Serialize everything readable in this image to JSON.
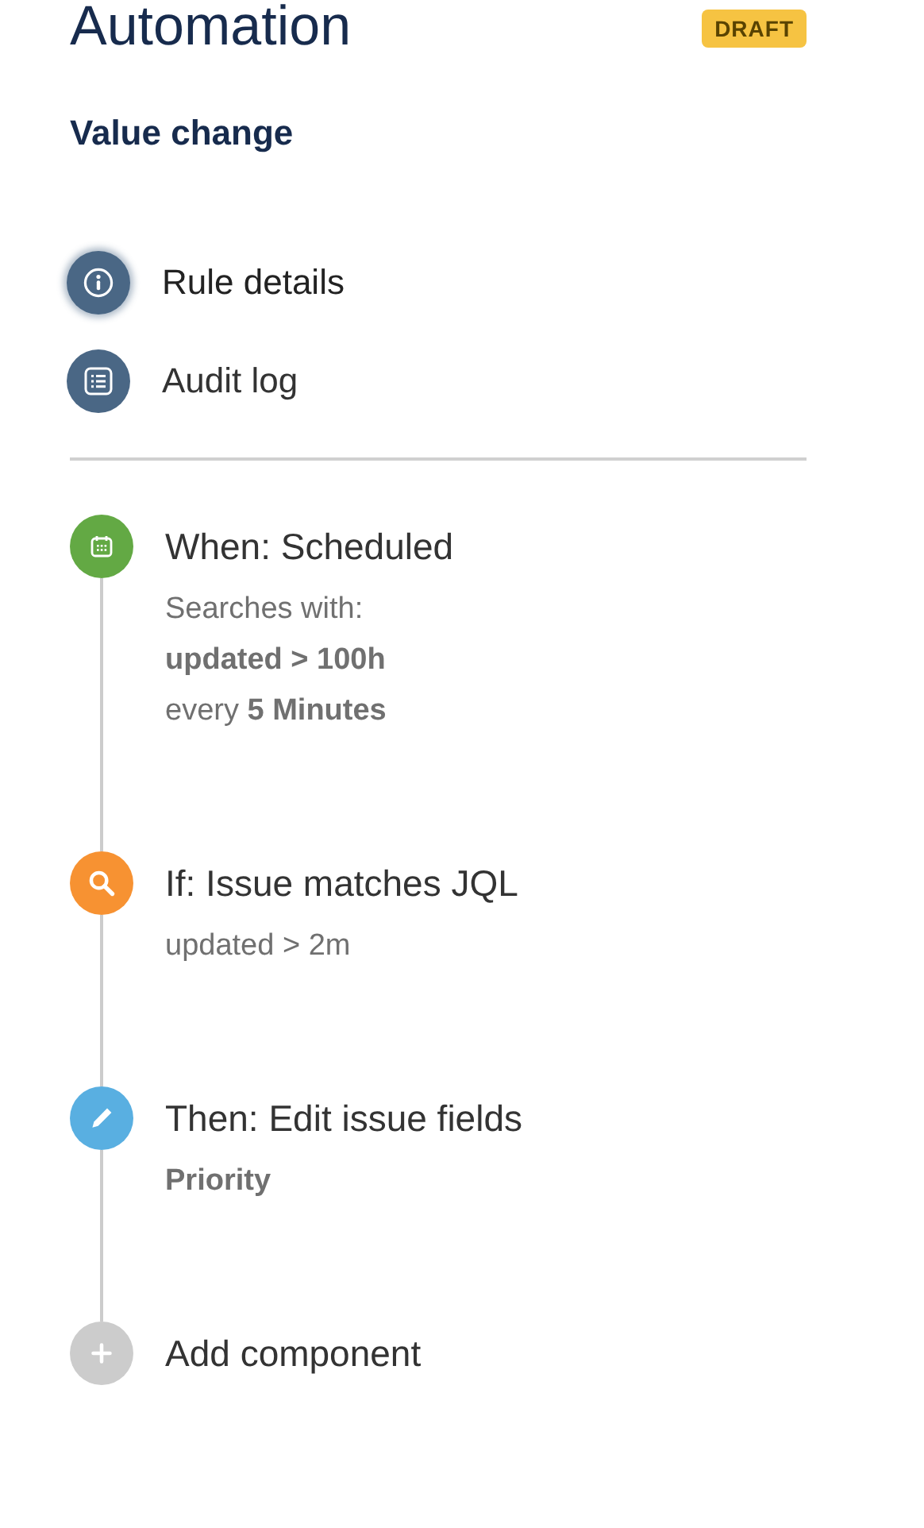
{
  "header": {
    "title": "Automation",
    "badge": "DRAFT"
  },
  "rule_name": "Value change",
  "nav": [
    {
      "kind": "info",
      "label": "Rule details",
      "selected": true
    },
    {
      "kind": "list",
      "label": "Audit log",
      "selected": false
    }
  ],
  "steps": [
    {
      "kind": "trigger",
      "title": "When: Scheduled",
      "details": [
        {
          "text": "Searches with:",
          "bold": false
        },
        {
          "text": "updated > 100h",
          "bold": true
        },
        {
          "text": "every **5 Minutes**",
          "bold": false
        }
      ]
    },
    {
      "kind": "condition",
      "title": "If: Issue matches JQL",
      "details": [
        {
          "text": "updated > 2m",
          "bold": false
        }
      ]
    },
    {
      "kind": "action",
      "title": "Then: Edit issue fields",
      "details": [
        {
          "text": "Priority",
          "bold": true
        }
      ]
    },
    {
      "kind": "add",
      "title": "Add component"
    }
  ]
}
